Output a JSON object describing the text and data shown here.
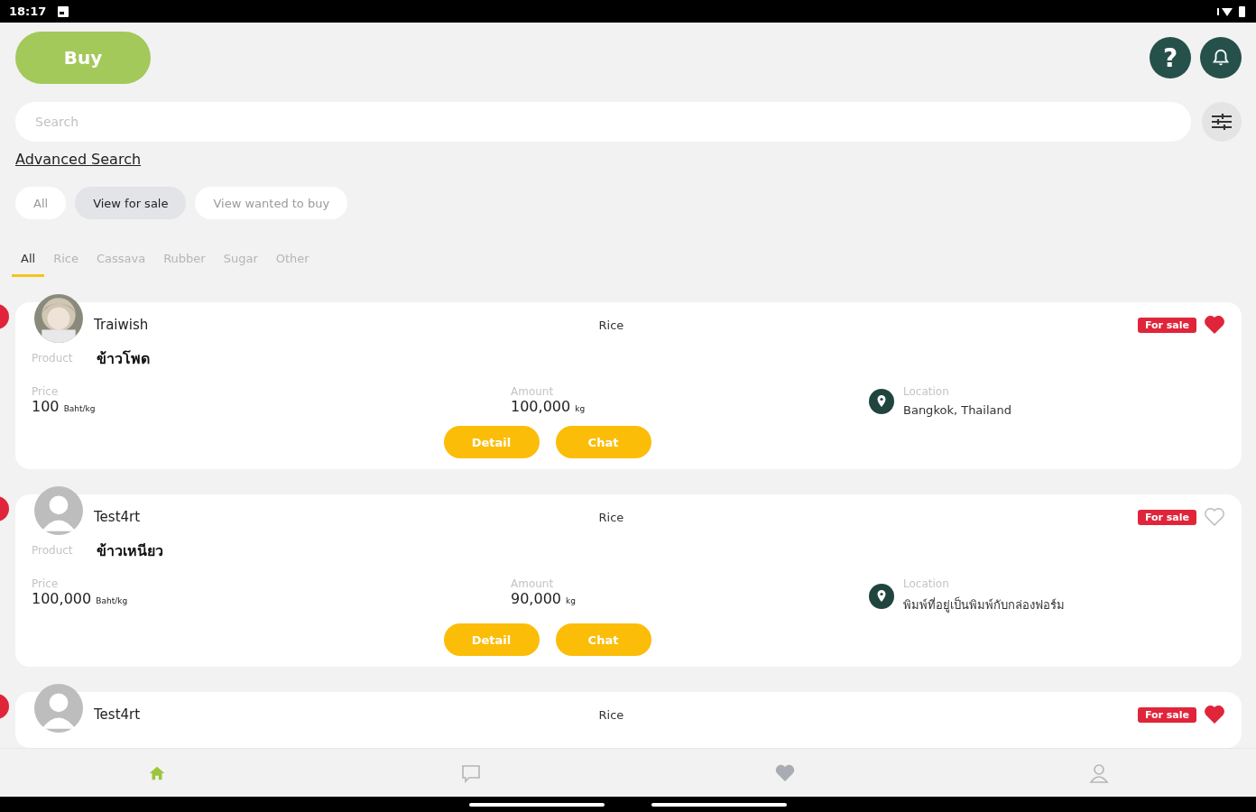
{
  "status_bar": {
    "time": "18:17"
  },
  "header": {
    "buy_button": "Buy",
    "help_label": "?"
  },
  "search": {
    "placeholder": "Search"
  },
  "advanced_search": "Advanced Search",
  "filters": [
    {
      "label": "All",
      "selected": false
    },
    {
      "label": "View for sale",
      "selected": true
    },
    {
      "label": "View wanted to buy",
      "selected": false
    }
  ],
  "category_tabs": [
    {
      "label": "All",
      "selected": true
    },
    {
      "label": "Rice",
      "selected": false
    },
    {
      "label": "Cassava",
      "selected": false
    },
    {
      "label": "Rubber",
      "selected": false
    },
    {
      "label": "Sugar",
      "selected": false
    },
    {
      "label": "Other",
      "selected": false
    }
  ],
  "listings": [
    {
      "has_photo": true,
      "seller": "Traiwish",
      "category": "Rice",
      "badge": "For sale",
      "favorite": true,
      "product_label": "Product",
      "product": "ข้าวโพด",
      "price_label": "Price",
      "price": "100",
      "price_unit": "Baht/kg",
      "amount_label": "Amount",
      "amount": "100,000",
      "amount_unit": "kg",
      "location_label": "Location",
      "location": "Bangkok, Thailand",
      "buttons": [
        "Detail",
        "Chat"
      ]
    },
    {
      "has_photo": false,
      "seller": "Test4rt",
      "category": "Rice",
      "badge": "For sale",
      "favorite": false,
      "product_label": "Product",
      "product": "ข้าวเหนียว",
      "price_label": "Price",
      "price": "100,000",
      "price_unit": "Baht/kg",
      "amount_label": "Amount",
      "amount": "90,000",
      "amount_unit": "kg",
      "location_label": "Location",
      "location": "พิมพ์ที่อยู่เป็นพิมพ์กับกล่องฟอร์ม",
      "buttons": [
        "Detail",
        "Chat"
      ]
    },
    {
      "has_photo": false,
      "seller": "Test4rt",
      "category": "Rice",
      "badge": "For sale",
      "favorite": true
    }
  ],
  "bottom_nav": [
    {
      "kind": "home",
      "selected": true
    },
    {
      "kind": "chat",
      "selected": false
    },
    {
      "kind": "favorites",
      "selected": false
    },
    {
      "kind": "profile",
      "selected": false
    }
  ]
}
